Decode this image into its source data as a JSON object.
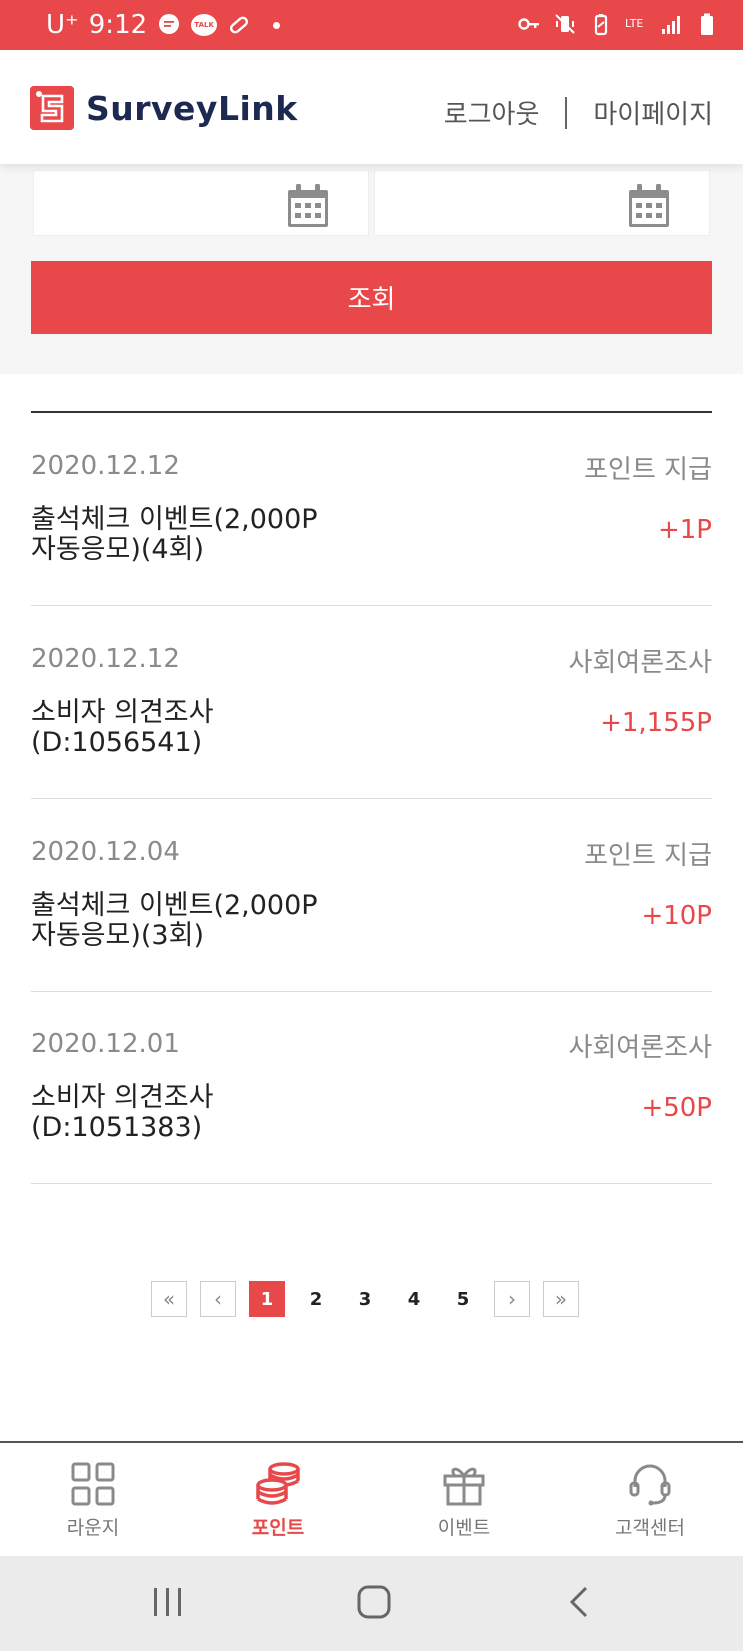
{
  "status_bar": {
    "carrier": "U⁺",
    "time": "9:12",
    "talk_badge": "TALK",
    "network": "LTE"
  },
  "header": {
    "logo_text": "SurveyLink",
    "logout_label": "로그아웃",
    "mypage_label": "마이페이지"
  },
  "filter": {
    "start_date": "",
    "end_date": "",
    "search_label": "조회"
  },
  "history": [
    {
      "date": "2020.12.12",
      "category": "포인트 지급",
      "title": "출석체크 이벤트(2,000P\n자동응모)(4회)",
      "points": "+1P"
    },
    {
      "date": "2020.12.12",
      "category": "사회여론조사",
      "title": "소비자 의견조사\n(D:1056541)",
      "points": "+1,155P"
    },
    {
      "date": "2020.12.04",
      "category": "포인트 지급",
      "title": "출석체크 이벤트(2,000P\n자동응모)(3회)",
      "points": "+10P"
    },
    {
      "date": "2020.12.01",
      "category": "사회여론조사",
      "title": "소비자 의견조사\n(D:1051383)",
      "points": "+50P"
    }
  ],
  "pagination": {
    "first": "«",
    "prev": "‹",
    "pages": [
      "1",
      "2",
      "3",
      "4",
      "5"
    ],
    "current": "1",
    "next": "›",
    "last": "»"
  },
  "bottom_nav": [
    {
      "label": "라운지",
      "icon": "grid-icon"
    },
    {
      "label": "포인트",
      "icon": "coins-icon",
      "active": true
    },
    {
      "label": "이벤트",
      "icon": "gift-icon"
    },
    {
      "label": "고객센터",
      "icon": "headset-icon"
    }
  ],
  "colors": {
    "accent": "#e8484a",
    "brand_text": "#1d2950"
  }
}
